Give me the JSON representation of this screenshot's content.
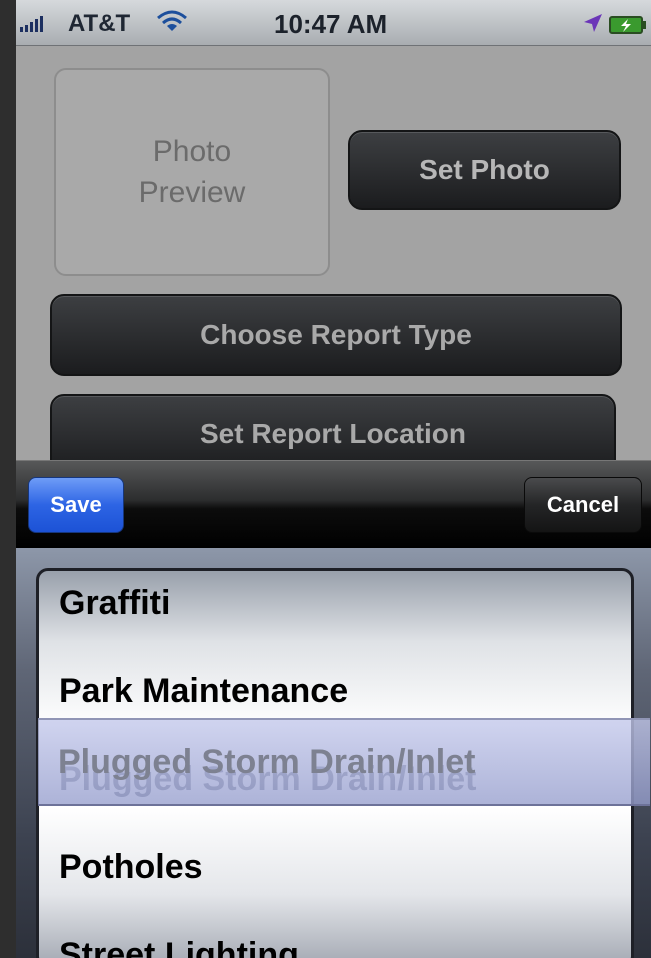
{
  "status_bar": {
    "carrier": "AT&T",
    "time": "10:47 AM"
  },
  "form": {
    "photo_preview": "Photo\nPreview",
    "set_photo_label": "Set Photo",
    "report_type_label": "Choose Report Type",
    "report_location_label": "Set Report Location"
  },
  "toolbar": {
    "save_label": "Save",
    "cancel_label": "Cancel"
  },
  "picker": {
    "items": [
      "Graffiti",
      "Park Maintenance",
      "Plugged Storm Drain/Inlet",
      "Potholes",
      "Street Lighting"
    ],
    "selected": "Plugged Storm Drain/Inlet"
  },
  "colors": {
    "save_accent": "#2d64e4",
    "selection_tint": "#c3c8eb"
  }
}
